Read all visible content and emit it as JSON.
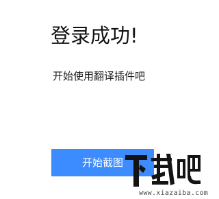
{
  "header": {
    "title": "登录成功!"
  },
  "body": {
    "message": "开始使用翻译插件吧"
  },
  "actions": {
    "start_button_label": "开始截图"
  },
  "colors": {
    "primary": "#3c8bff",
    "background": "#ffffff",
    "text": "#111111"
  },
  "watermark": {
    "logo_text": "下载吧",
    "url": "www.xiazaiba.com",
    "icon": "xiazaiba-logo"
  }
}
